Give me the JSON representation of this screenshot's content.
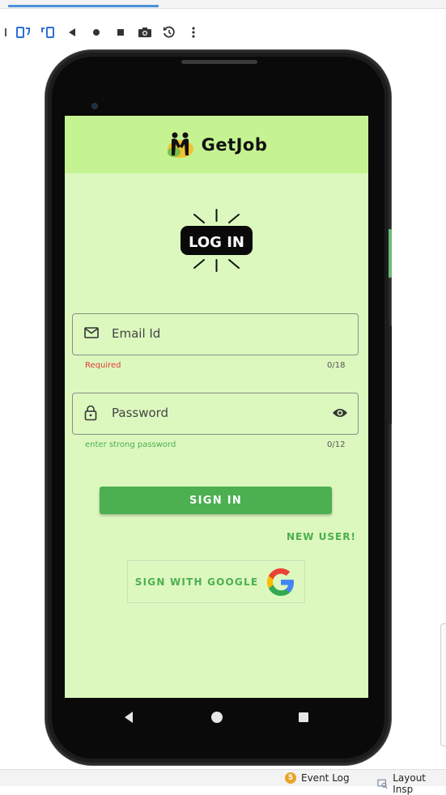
{
  "app": {
    "brand_name": "GetJob",
    "badge_text": "LOG IN"
  },
  "form": {
    "email": {
      "placeholder": "Email Id",
      "helper": "Required",
      "counter": "0/18"
    },
    "password": {
      "placeholder": "Password",
      "helper": "enter strong password",
      "counter": "0/12"
    },
    "sign_in_label": "SIGN IN",
    "new_user_label": "NEW USER!",
    "google_label": "SIGN WITH GOOGLE"
  },
  "ide": {
    "status_items": [
      {
        "label": "Event Log",
        "badge": "5"
      },
      {
        "label": "Layout Insp"
      }
    ]
  },
  "colors": {
    "screen_bg": "#dcf8be",
    "app_bar": "#c5f391",
    "accent_green": "#4caf50",
    "error_red": "#e53935"
  }
}
